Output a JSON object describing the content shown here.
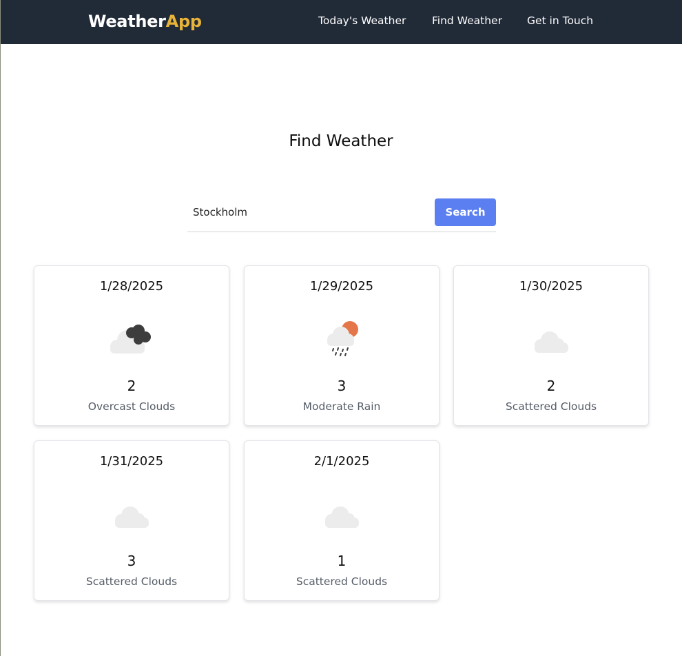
{
  "brand": {
    "part1": "Weather",
    "part2": "App"
  },
  "nav": [
    {
      "label": "Today's Weather"
    },
    {
      "label": "Find Weather"
    },
    {
      "label": "Get in Touch"
    }
  ],
  "page": {
    "title": "Find Weather"
  },
  "search": {
    "value": "Stockholm",
    "button_label": "Search"
  },
  "forecast": [
    {
      "date": "1/28/2025",
      "temp": "2",
      "description": "Overcast Clouds",
      "icon": "overcast-clouds-icon"
    },
    {
      "date": "1/29/2025",
      "temp": "3",
      "description": "Moderate Rain",
      "icon": "moderate-rain-icon"
    },
    {
      "date": "1/30/2025",
      "temp": "2",
      "description": "Scattered Clouds",
      "icon": "scattered-clouds-icon"
    },
    {
      "date": "1/31/2025",
      "temp": "3",
      "description": "Scattered Clouds",
      "icon": "scattered-clouds-icon"
    },
    {
      "date": "2/1/2025",
      "temp": "1",
      "description": "Scattered Clouds",
      "icon": "scattered-clouds-icon"
    }
  ],
  "colors": {
    "navbar_bg": "#212a37",
    "brand_accent": "#e8b339",
    "button_bg": "#5b7ff0",
    "sun": "#e4764a"
  }
}
